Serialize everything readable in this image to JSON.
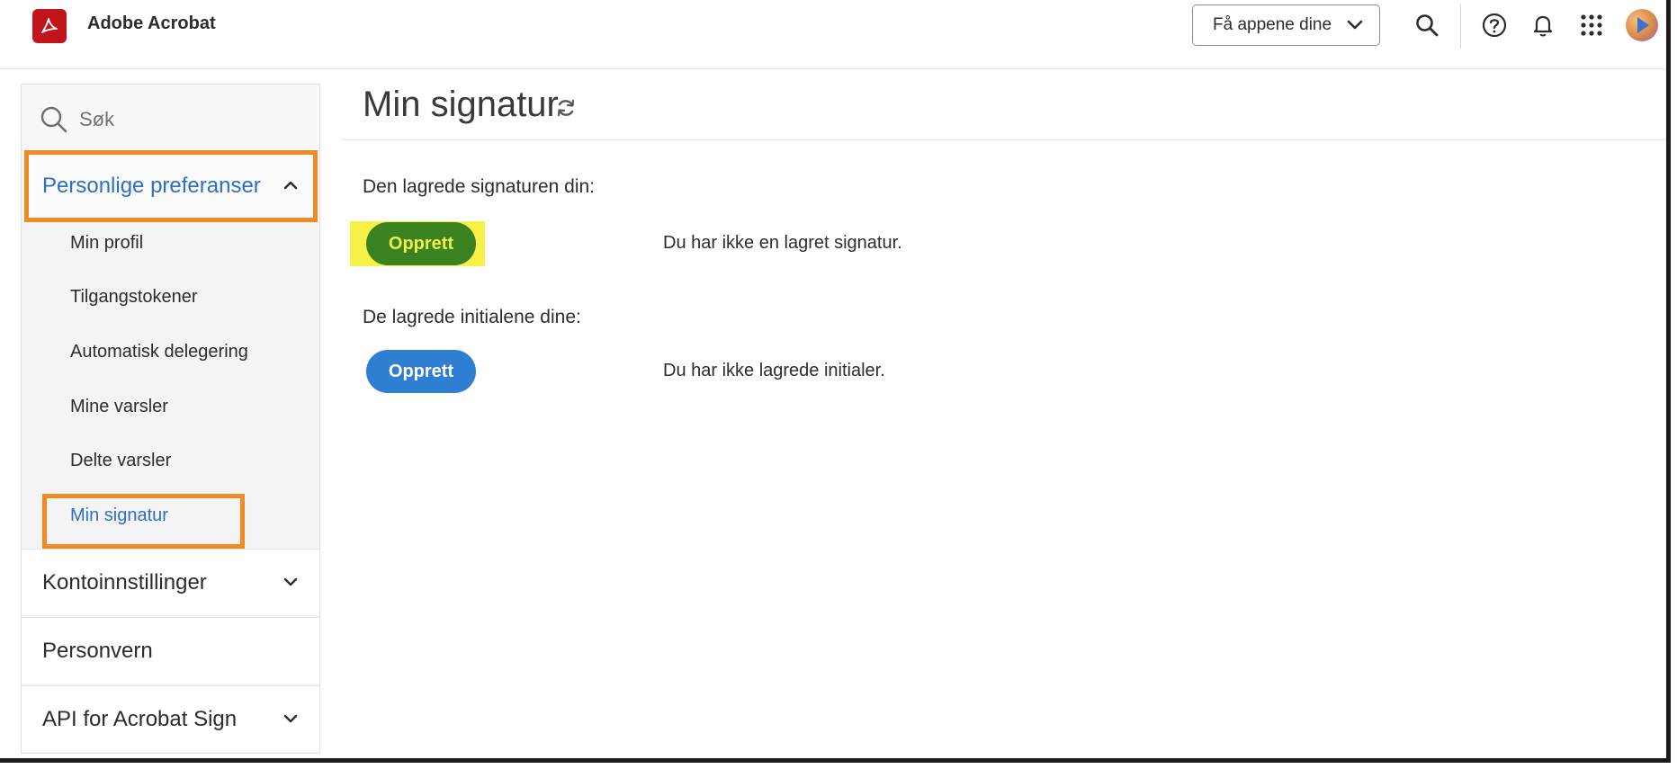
{
  "app": {
    "title": "Adobe Acrobat"
  },
  "header": {
    "apps_button": "Få appene dine",
    "icons": [
      "search-icon",
      "help-icon",
      "bell-icon",
      "apps-grid-icon",
      "avatar"
    ]
  },
  "sidebar": {
    "search_placeholder": "Søk",
    "sections": [
      {
        "label": "Personlige preferanser",
        "expanded": true,
        "items": [
          "Min profil",
          "Tilgangstokener",
          "Automatisk delegering",
          "Mine varsler",
          "Delte varsler",
          "Min signatur"
        ],
        "active_item": "Min signatur"
      },
      {
        "label": "Kontoinnstillinger",
        "expanded": false
      },
      {
        "label": "Personvern",
        "expanded": false
      },
      {
        "label": "API for Acrobat Sign",
        "expanded": false
      }
    ]
  },
  "main": {
    "title": "Min signatur",
    "signature": {
      "label": "Den lagrede signaturen din:",
      "button": "Opprett",
      "status": "Du har ikke en lagret signatur."
    },
    "initials": {
      "label": "De lagrede initialene dine:",
      "button": "Opprett",
      "status": "Du har ikke lagrede initialer."
    }
  },
  "colors": {
    "accent": "#2b70c3",
    "button_blue": "#2e7ed2",
    "button_green": "#3b8220",
    "highlight_yellow": "#f7f147",
    "highlight_orange": "#f08a24",
    "brand_red": "#c2141b"
  }
}
